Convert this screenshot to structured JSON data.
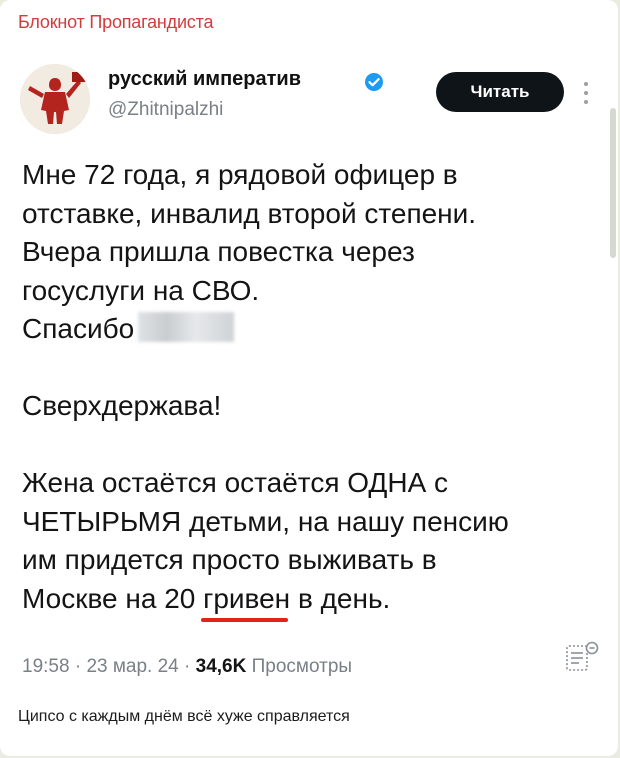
{
  "channel": {
    "name": "Блокнот Пропагандиста"
  },
  "tweet": {
    "display_name": "русский императив",
    "handle": "@Zhitnipalzhi",
    "read_button": "Читать",
    "lines": {
      "p1_l1": "Мне 72 года, я рядовой офицер в",
      "p1_l2": "отставке, инвалид второй степени.",
      "p1_l3": "Вчера пришла повестка через",
      "p1_l4": "госуслуги на СВО.",
      "p1_l5": "Спасибо",
      "p2": "Сверхдержава!",
      "p3_l1": "Жена остаётся остаётся ОДНА с",
      "p3_l2": "ЧЕТЫРЬМЯ детьми, на нашу пенсию",
      "p3_l3": "им придется просто выживать в",
      "p3_l4_pre": "Москве на 20",
      "p3_l4_mark": "гривен",
      "p3_l4_post": "в день."
    },
    "time": "19:58",
    "date": "23 мар. 24",
    "separator": " · ",
    "views_count": "34,6K",
    "views_label": "Просмотры"
  },
  "caption": "Ципсо с каждым днём всё хуже справляется",
  "colors": {
    "channel_name": "#d23c3c",
    "verified": "#1d9bf0",
    "underline": "#e2231a",
    "button_bg": "#0f1419"
  }
}
